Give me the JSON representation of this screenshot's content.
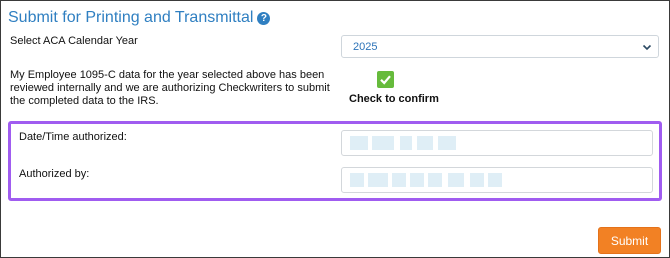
{
  "title": "Submit for Printing and Transmittal",
  "help_icon": "help-circle-icon",
  "year_field": {
    "label": "Select ACA Calendar Year",
    "value": "2025"
  },
  "confirm": {
    "statement": "My Employee 1095-C data for the year selected above has been reviewed internally and we are authorizing Checkwriters to submit the completed data to the IRS.",
    "checkbox_label": "Check to confirm",
    "checked": true
  },
  "authorization": {
    "date_label": "Date/Time authorized:",
    "by_label": "Authorized by:"
  },
  "submit_label": "Submit",
  "colors": {
    "accent_blue": "#2f7fc1",
    "check_green": "#66bb3c",
    "highlight_purple": "#a05cf0",
    "submit_orange": "#f28124"
  }
}
